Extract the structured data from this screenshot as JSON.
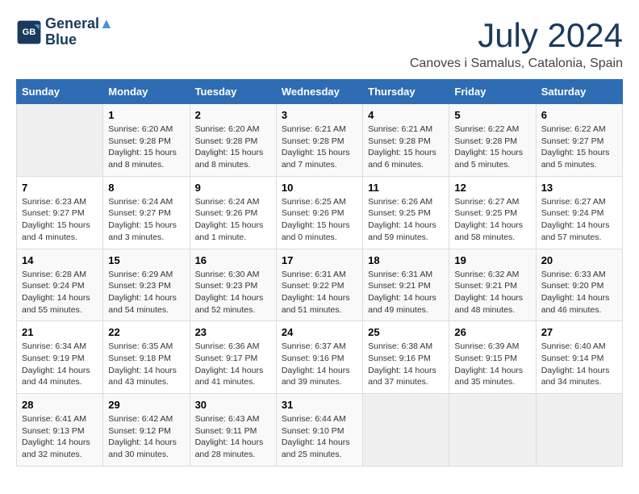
{
  "logo": {
    "line1": "General",
    "line2": "Blue"
  },
  "title": "July 2024",
  "location": "Canoves i Samalus, Catalonia, Spain",
  "headers": [
    "Sunday",
    "Monday",
    "Tuesday",
    "Wednesday",
    "Thursday",
    "Friday",
    "Saturday"
  ],
  "weeks": [
    [
      {
        "day": "",
        "empty": true
      },
      {
        "day": "1",
        "sunrise": "6:20 AM",
        "sunset": "9:28 PM",
        "daylight": "15 hours and 8 minutes."
      },
      {
        "day": "2",
        "sunrise": "6:20 AM",
        "sunset": "9:28 PM",
        "daylight": "15 hours and 8 minutes."
      },
      {
        "day": "3",
        "sunrise": "6:21 AM",
        "sunset": "9:28 PM",
        "daylight": "15 hours and 7 minutes."
      },
      {
        "day": "4",
        "sunrise": "6:21 AM",
        "sunset": "9:28 PM",
        "daylight": "15 hours and 6 minutes."
      },
      {
        "day": "5",
        "sunrise": "6:22 AM",
        "sunset": "9:28 PM",
        "daylight": "15 hours and 5 minutes."
      },
      {
        "day": "6",
        "sunrise": "6:22 AM",
        "sunset": "9:27 PM",
        "daylight": "15 hours and 5 minutes."
      }
    ],
    [
      {
        "day": "7",
        "sunrise": "6:23 AM",
        "sunset": "9:27 PM",
        "daylight": "15 hours and 4 minutes."
      },
      {
        "day": "8",
        "sunrise": "6:24 AM",
        "sunset": "9:27 PM",
        "daylight": "15 hours and 3 minutes."
      },
      {
        "day": "9",
        "sunrise": "6:24 AM",
        "sunset": "9:26 PM",
        "daylight": "15 hours and 1 minute."
      },
      {
        "day": "10",
        "sunrise": "6:25 AM",
        "sunset": "9:26 PM",
        "daylight": "15 hours and 0 minutes."
      },
      {
        "day": "11",
        "sunrise": "6:26 AM",
        "sunset": "9:25 PM",
        "daylight": "14 hours and 59 minutes."
      },
      {
        "day": "12",
        "sunrise": "6:27 AM",
        "sunset": "9:25 PM",
        "daylight": "14 hours and 58 minutes."
      },
      {
        "day": "13",
        "sunrise": "6:27 AM",
        "sunset": "9:24 PM",
        "daylight": "14 hours and 57 minutes."
      }
    ],
    [
      {
        "day": "14",
        "sunrise": "6:28 AM",
        "sunset": "9:24 PM",
        "daylight": "14 hours and 55 minutes."
      },
      {
        "day": "15",
        "sunrise": "6:29 AM",
        "sunset": "9:23 PM",
        "daylight": "14 hours and 54 minutes."
      },
      {
        "day": "16",
        "sunrise": "6:30 AM",
        "sunset": "9:23 PM",
        "daylight": "14 hours and 52 minutes."
      },
      {
        "day": "17",
        "sunrise": "6:31 AM",
        "sunset": "9:22 PM",
        "daylight": "14 hours and 51 minutes."
      },
      {
        "day": "18",
        "sunrise": "6:31 AM",
        "sunset": "9:21 PM",
        "daylight": "14 hours and 49 minutes."
      },
      {
        "day": "19",
        "sunrise": "6:32 AM",
        "sunset": "9:21 PM",
        "daylight": "14 hours and 48 minutes."
      },
      {
        "day": "20",
        "sunrise": "6:33 AM",
        "sunset": "9:20 PM",
        "daylight": "14 hours and 46 minutes."
      }
    ],
    [
      {
        "day": "21",
        "sunrise": "6:34 AM",
        "sunset": "9:19 PM",
        "daylight": "14 hours and 44 minutes."
      },
      {
        "day": "22",
        "sunrise": "6:35 AM",
        "sunset": "9:18 PM",
        "daylight": "14 hours and 43 minutes."
      },
      {
        "day": "23",
        "sunrise": "6:36 AM",
        "sunset": "9:17 PM",
        "daylight": "14 hours and 41 minutes."
      },
      {
        "day": "24",
        "sunrise": "6:37 AM",
        "sunset": "9:16 PM",
        "daylight": "14 hours and 39 minutes."
      },
      {
        "day": "25",
        "sunrise": "6:38 AM",
        "sunset": "9:16 PM",
        "daylight": "14 hours and 37 minutes."
      },
      {
        "day": "26",
        "sunrise": "6:39 AM",
        "sunset": "9:15 PM",
        "daylight": "14 hours and 35 minutes."
      },
      {
        "day": "27",
        "sunrise": "6:40 AM",
        "sunset": "9:14 PM",
        "daylight": "14 hours and 34 minutes."
      }
    ],
    [
      {
        "day": "28",
        "sunrise": "6:41 AM",
        "sunset": "9:13 PM",
        "daylight": "14 hours and 32 minutes."
      },
      {
        "day": "29",
        "sunrise": "6:42 AM",
        "sunset": "9:12 PM",
        "daylight": "14 hours and 30 minutes."
      },
      {
        "day": "30",
        "sunrise": "6:43 AM",
        "sunset": "9:11 PM",
        "daylight": "14 hours and 28 minutes."
      },
      {
        "day": "31",
        "sunrise": "6:44 AM",
        "sunset": "9:10 PM",
        "daylight": "14 hours and 25 minutes."
      },
      {
        "day": "",
        "empty": true
      },
      {
        "day": "",
        "empty": true
      },
      {
        "day": "",
        "empty": true
      }
    ]
  ]
}
